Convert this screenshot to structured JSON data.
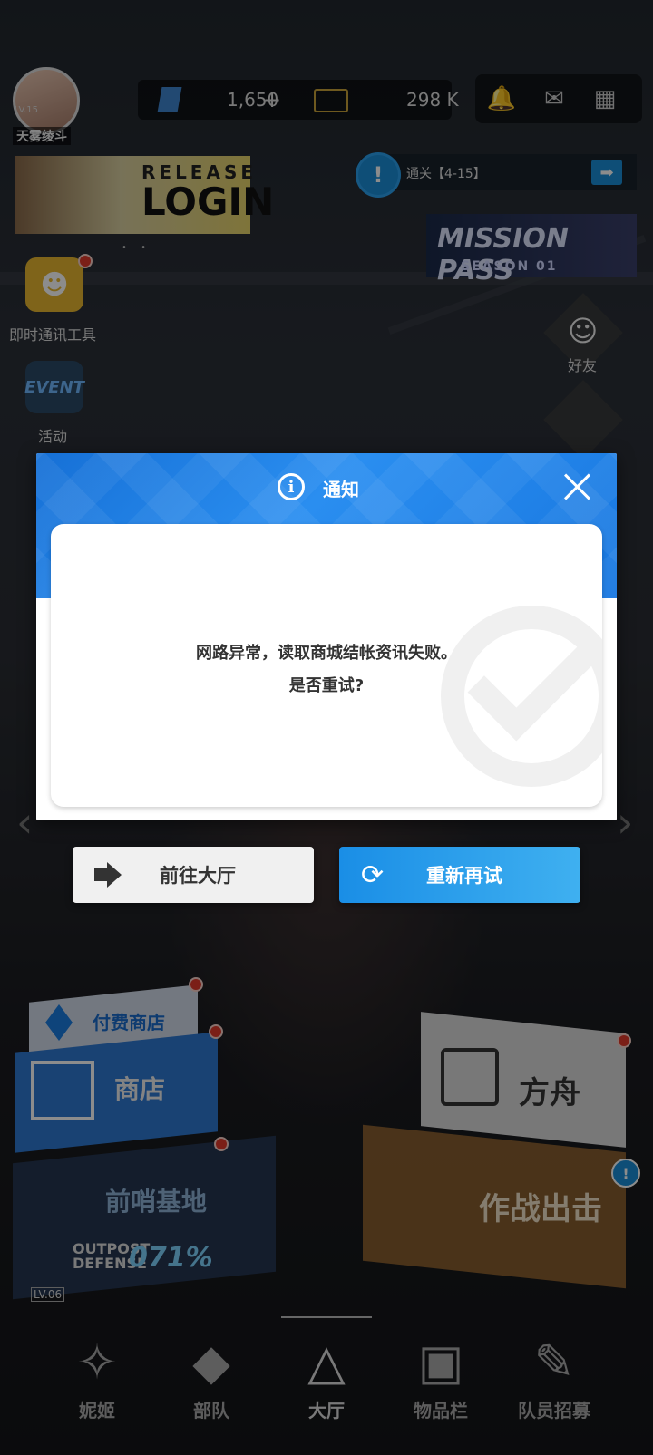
{
  "player": {
    "name": "天雾绫斗",
    "level": "LV.15"
  },
  "currency": {
    "gems": "1,650",
    "plus": "+",
    "credits": "298 K"
  },
  "top_icons": [
    "bell-icon",
    "mail-icon",
    "grid-menu-icon"
  ],
  "banner": {
    "line1": "RELEASE",
    "line2": "LOGIN",
    "dots": "• •"
  },
  "quest": {
    "icon": "!",
    "text": "通关【4-15】",
    "go": "➡"
  },
  "mission_pass": {
    "title": "MISSION PASS",
    "season": "SEASON 01"
  },
  "left_menu": {
    "chat_label": "即时通讯工具",
    "event_label": "活动",
    "event_icon_text": "EVENT"
  },
  "right_menu": {
    "friend_label": "好友"
  },
  "dialog": {
    "info_glyph": "i",
    "title": "通知",
    "message_line1": "网路异常，读取商城结帐资讯失败。",
    "message_line2": "是否重试?"
  },
  "buttons": {
    "lobby": "前往大厅",
    "retry": "重新再试"
  },
  "lobby": {
    "paid_shop": "付费商店",
    "shop": "商店",
    "outpost": "前哨基地",
    "outpost_defense_1": "OUTPOST",
    "outpost_defense_2": "DEFENSE",
    "outpost_pct": "071%",
    "outpost_lv": "LV.06",
    "ark": "方舟",
    "sortie": "作战出击",
    "sortie_alert": "!"
  },
  "nav": [
    {
      "label": "妮姬",
      "icon": "nikke-icon"
    },
    {
      "label": "部队",
      "icon": "squad-icon"
    },
    {
      "label": "大厅",
      "icon": "lobby-icon",
      "active": true
    },
    {
      "label": "物品栏",
      "icon": "inventory-icon"
    },
    {
      "label": "队员招募",
      "icon": "recruit-icon"
    }
  ],
  "colors": {
    "accent": "#1b8fd9",
    "dialog_header": "#1f80e6",
    "alert": "#e03a2a"
  }
}
